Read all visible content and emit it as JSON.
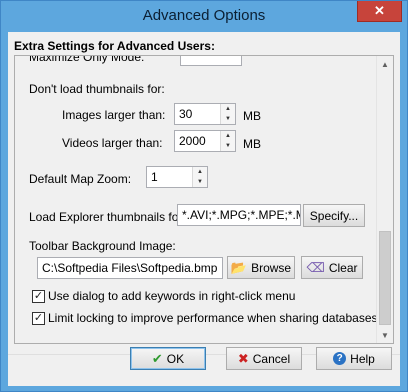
{
  "window": {
    "title": "Advanced Options",
    "close_glyph": "✕",
    "header_label": "Extra Settings for Advanced Users:"
  },
  "panel": {
    "cut_label": "Maximize Only Mode:",
    "dont_load_label": "Don't load thumbnails for:",
    "images_label": "Images larger than:",
    "images_value": "30",
    "images_unit": "MB",
    "videos_label": "Videos larger than:",
    "videos_value": "2000",
    "videos_unit": "MB",
    "map_zoom_label": "Default Map Zoom:",
    "map_zoom_value": "1",
    "explorer_label": "Load Explorer thumbnails for:",
    "explorer_value": "*.AVI;*.MPG;*.MPE;*.M",
    "specify_label": "Specify...",
    "toolbar_bg_label": "Toolbar Background Image:",
    "toolbar_bg_value": "C:\\Softpedia Files\\Softpedia.bmp",
    "browse_label": "Browse",
    "clear_label": "Clear",
    "check1_label": "Use dialog to add keywords in right-click menu",
    "check1_checked": true,
    "check2_label": "Limit locking to improve performance when sharing databases",
    "check2_checked": true,
    "check_glyph": "✓"
  },
  "footer": {
    "ok_label": "OK",
    "cancel_label": "Cancel",
    "help_label": "Help"
  },
  "icons": {
    "up": "▲",
    "down": "▼",
    "ok": "✔",
    "cancel": "✖",
    "help": "?",
    "browse": "📂",
    "clear": "⌫"
  },
  "colors": {
    "title_bar": "#5da7de",
    "close_button": "#c7443b",
    "ok_check": "#2e9a2e",
    "cancel_x": "#cc2222",
    "help_icon": "#2a72c4"
  }
}
